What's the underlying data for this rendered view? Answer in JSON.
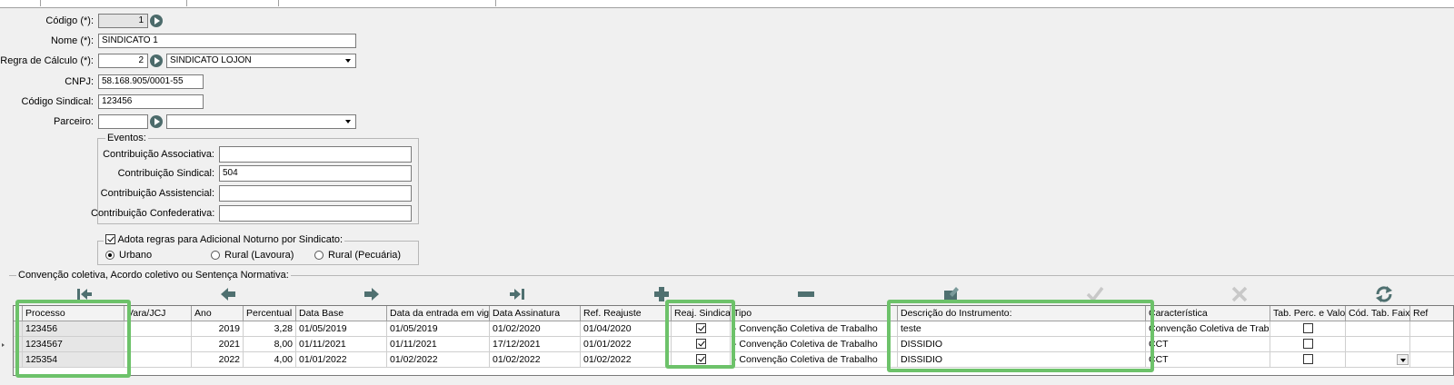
{
  "form": {
    "codigo": {
      "label": "Código (*):",
      "value": "1"
    },
    "nome": {
      "label": "Nome (*):",
      "value": "SINDICATO 1"
    },
    "regra": {
      "label": "Regra de Cálculo (*):",
      "code": "2",
      "desc": "SINDICATO LOJON"
    },
    "cnpj": {
      "label": "CNPJ:",
      "value": "58.168.905/0001-55"
    },
    "codigo_sindical": {
      "label": "Código Sindical:",
      "value": "123456"
    },
    "parceiro": {
      "label": "Parceiro:",
      "code": "",
      "desc": ""
    }
  },
  "eventos": {
    "title": "Eventos:",
    "associativa": {
      "label": "Contribuição Associativa:",
      "value": ""
    },
    "sindical": {
      "label": "Contribuição Sindical:",
      "value": "504"
    },
    "assistencial": {
      "label": "Contribuição Assistencial:",
      "value": ""
    },
    "confederativa": {
      "label": "Contribuição Confederativa:",
      "value": ""
    }
  },
  "noturno": {
    "checkbox_label": "Adota regras para Adicional Noturno por Sindicato:",
    "checked": true,
    "options": [
      "Urbano",
      "Rural (Lavoura)",
      "Rural (Pecuária)"
    ],
    "selected": "Urbano"
  },
  "convencao": {
    "title": "Convenção coletiva, Acordo coletivo ou Sentença Normativa:"
  },
  "toolbar": [
    "first-icon",
    "prev-icon",
    "next-icon",
    "last-icon",
    "add-icon",
    "remove-icon",
    "edit-icon",
    "confirm-icon",
    "cancel-icon",
    "refresh-icon"
  ],
  "table": {
    "headers": [
      "Processo",
      "Vara/JCJ",
      "Ano",
      "Percentual",
      "Data Base",
      "Data da entrada em vigor",
      "Data Assinatura",
      "Ref. Reajuste",
      "Reaj. Sindical",
      "Tipo",
      "Descrição do Instrumento:",
      "Característica",
      "Tab. Perc. e Valor",
      "Cód. Tab. Faixa",
      "Ref"
    ],
    "rows": [
      {
        "processo": "123456",
        "vara": "",
        "ano": "2019",
        "percentual": "3,28",
        "data_base": "01/05/2019",
        "vigor": "01/05/2019",
        "assinatura": "01/02/2020",
        "ref_reajuste": "01/04/2020",
        "reaj": true,
        "tipo": "- Convenção Coletiva de Trabalho",
        "descricao": "teste",
        "caracteristica": "Convenção Coletiva de Trabalho",
        "tab_perc": false,
        "cod_faixa": "",
        "ref": ""
      },
      {
        "processo": "1234567",
        "vara": "",
        "ano": "2021",
        "percentual": "8,00",
        "data_base": "01/11/2021",
        "vigor": "01/11/2021",
        "assinatura": "17/12/2021",
        "ref_reajuste": "01/01/2022",
        "reaj": true,
        "tipo": "- Convenção Coletiva de Trabalho",
        "descricao": "DISSIDIO",
        "caracteristica": "CCT",
        "tab_perc": false,
        "cod_faixa": "",
        "ref": ""
      },
      {
        "processo": "125354",
        "vara": "",
        "ano": "2022",
        "percentual": "4,00",
        "data_base": "01/01/2022",
        "vigor": "01/02/2022",
        "assinatura": "01/02/2022",
        "ref_reajuste": "01/02/2022",
        "reaj": true,
        "tipo": "- Convenção Coletiva de Trabalho",
        "descricao": "DISSIDIO",
        "caracteristica": "CCT",
        "tab_perc": false,
        "cod_faixa": "",
        "ref": ""
      }
    ]
  },
  "colors": {
    "highlight": "#6dc26a",
    "nav_button": "#4c6b6b",
    "toolbar_active": "#4f7070",
    "toolbar_disabled": "#c8c8c8"
  }
}
